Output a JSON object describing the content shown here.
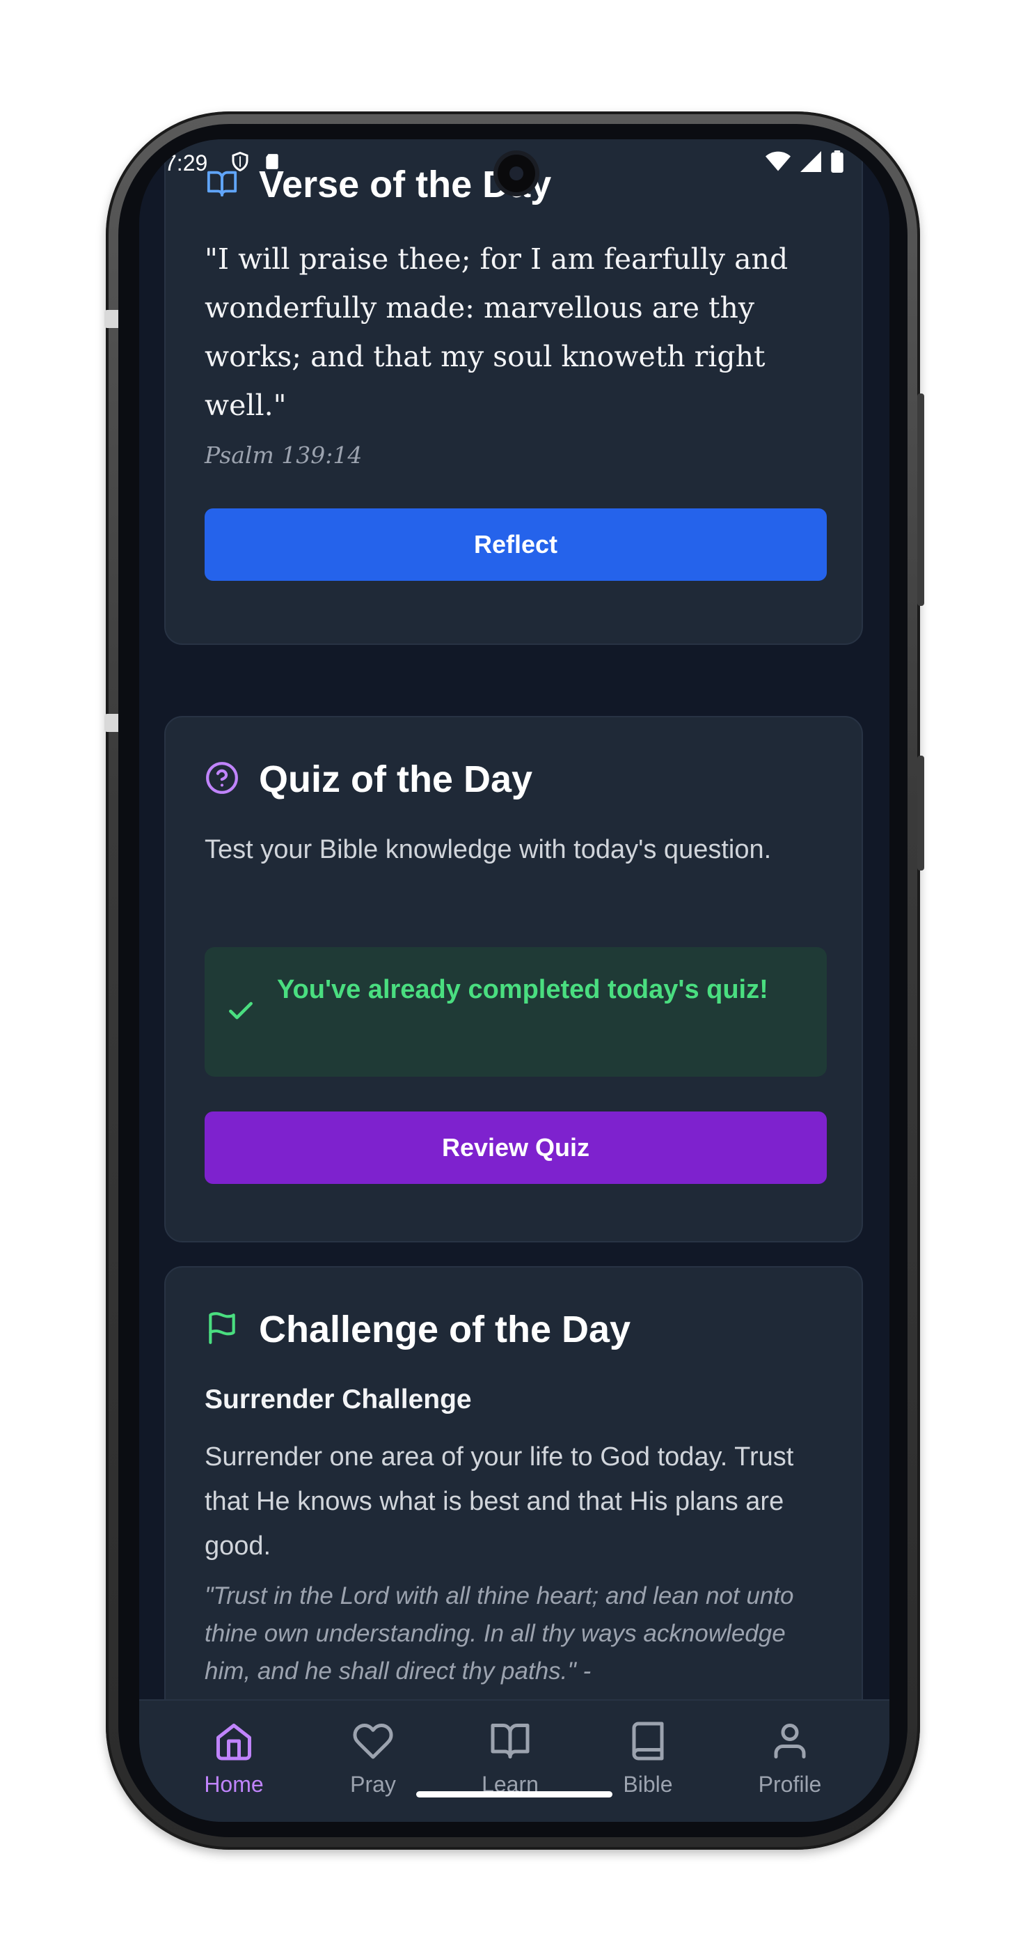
{
  "status_bar": {
    "time": "7:29"
  },
  "verse_card": {
    "title": "Verse of the Day",
    "icon": "book-open-icon",
    "verse": "\"I will praise thee; for I am fearfully and wonderfully made: marvellous are thy works; and that my soul knoweth right well.\"",
    "reference": "Psalm 139:14",
    "button_label": "Reflect"
  },
  "quiz_card": {
    "title": "Quiz of the Day",
    "icon": "help-circle-icon",
    "description": "Test your Bible knowledge with today's question.",
    "completed_message": "You've already completed today's quiz!",
    "button_label": "Review Quiz"
  },
  "challenge_card": {
    "title": "Challenge of the Day",
    "icon": "flag-icon",
    "challenge_name": "Surrender Challenge",
    "description": "Surrender one area of your life to God today. Trust that He knows what is best and that His plans are good.",
    "quote": "\"Trust in the Lord with all thine heart; and lean not unto thine own understanding. In all thy ways acknowledge him, and he shall direct thy paths.\" -"
  },
  "nav": {
    "items": [
      {
        "label": "Home",
        "icon": "home-icon",
        "active": true
      },
      {
        "label": "Pray",
        "icon": "heart-icon",
        "active": false
      },
      {
        "label": "Learn",
        "icon": "book-open-icon",
        "active": false
      },
      {
        "label": "Bible",
        "icon": "book-icon",
        "active": false
      },
      {
        "label": "Profile",
        "icon": "user-icon",
        "active": false
      }
    ]
  },
  "colors": {
    "background": "#111827",
    "card": "#1f2937",
    "primary_blue": "#2563eb",
    "primary_purple": "#7e22ce",
    "success_green": "#4ade80",
    "active_nav": "#c084fc"
  }
}
